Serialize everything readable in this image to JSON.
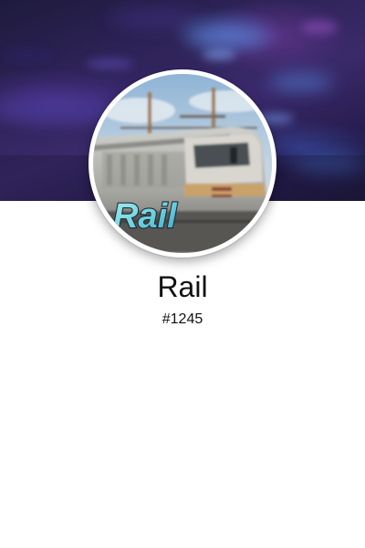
{
  "profile": {
    "name": "Rail",
    "tag": "#1245",
    "avatar_logo_text": "Rail"
  },
  "colors": {
    "banner_base": "#2e2358",
    "banner_accent_blue": "#4f78c8",
    "banner_accent_purple": "#7a3ca0",
    "page_background": "#ffffff",
    "text": "#111111",
    "logo_fill": "#6fd3e0"
  }
}
